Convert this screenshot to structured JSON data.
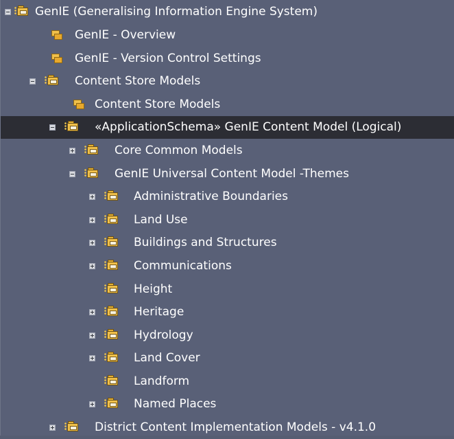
{
  "tree": {
    "rows": [
      {
        "label": "GenIE (Generalising Information Engine System)"
      },
      {
        "label": "GenIE - Overview"
      },
      {
        "label": "GenIE - Version Control Settings"
      },
      {
        "label": "Content Store Models"
      },
      {
        "label": "Content Store Models"
      },
      {
        "label": "«ApplicationSchema» GenIE Content Model (Logical)"
      },
      {
        "label": "Core Common Models"
      },
      {
        "label": "GenIE Universal Content Model -Themes"
      },
      {
        "label": "Administrative Boundaries"
      },
      {
        "label": "Land Use"
      },
      {
        "label": "Buildings and Structures"
      },
      {
        "label": "Communications"
      },
      {
        "label": "Height"
      },
      {
        "label": "Heritage"
      },
      {
        "label": "Hydrology"
      },
      {
        "label": "Land Cover"
      },
      {
        "label": "Landform"
      },
      {
        "label": "Named Places"
      },
      {
        "label": "District Content Implementation Models - v4.1.0"
      }
    ]
  },
  "colors": {
    "background": "#596077",
    "selected_row": "#2c2d34",
    "text": "#ffffff",
    "package_icon": "#f0c04b"
  }
}
